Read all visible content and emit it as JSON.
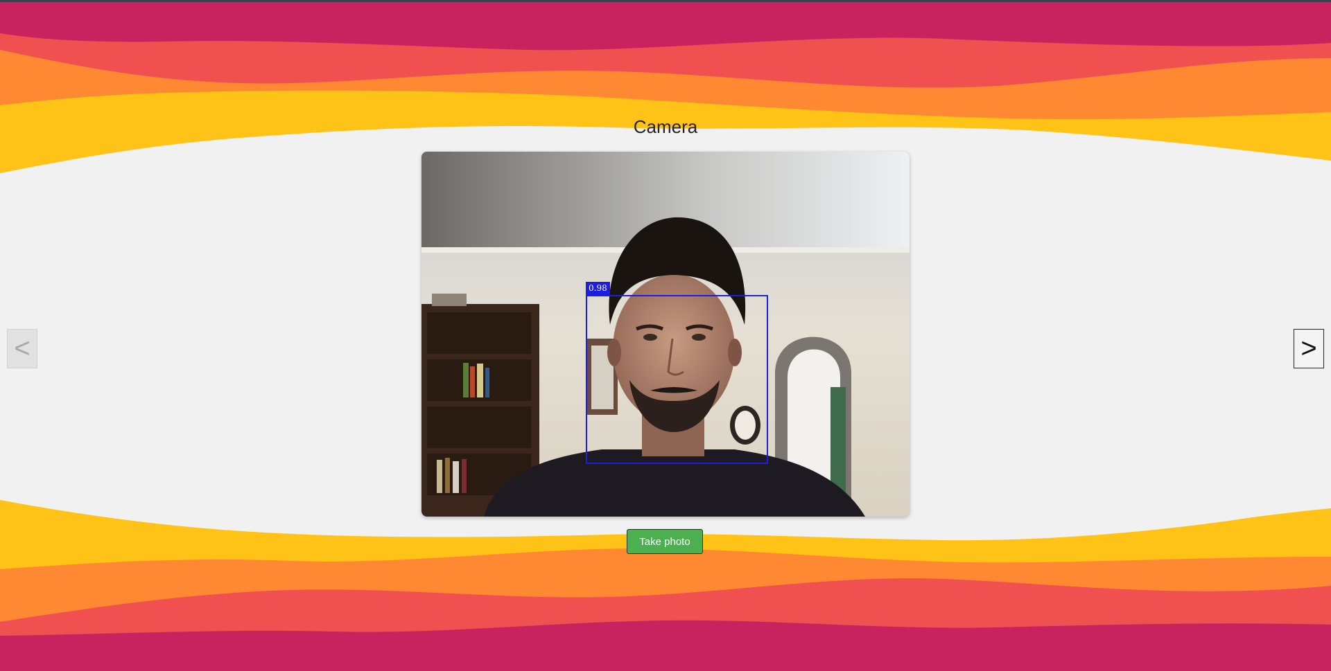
{
  "page": {
    "title": "Camera"
  },
  "camera": {
    "detection_score": "0.98"
  },
  "controls": {
    "take_photo_label": "Take photo",
    "prev_label": "<",
    "next_label": ">"
  },
  "colors": {
    "wave_magenta": "#c8235f",
    "wave_coral": "#f0504f",
    "wave_orange": "#ff8833",
    "wave_yellow": "#ffc216",
    "background": "#f1f1f1",
    "button_green": "#4caf50",
    "detection_blue": "#1e1ee0"
  }
}
